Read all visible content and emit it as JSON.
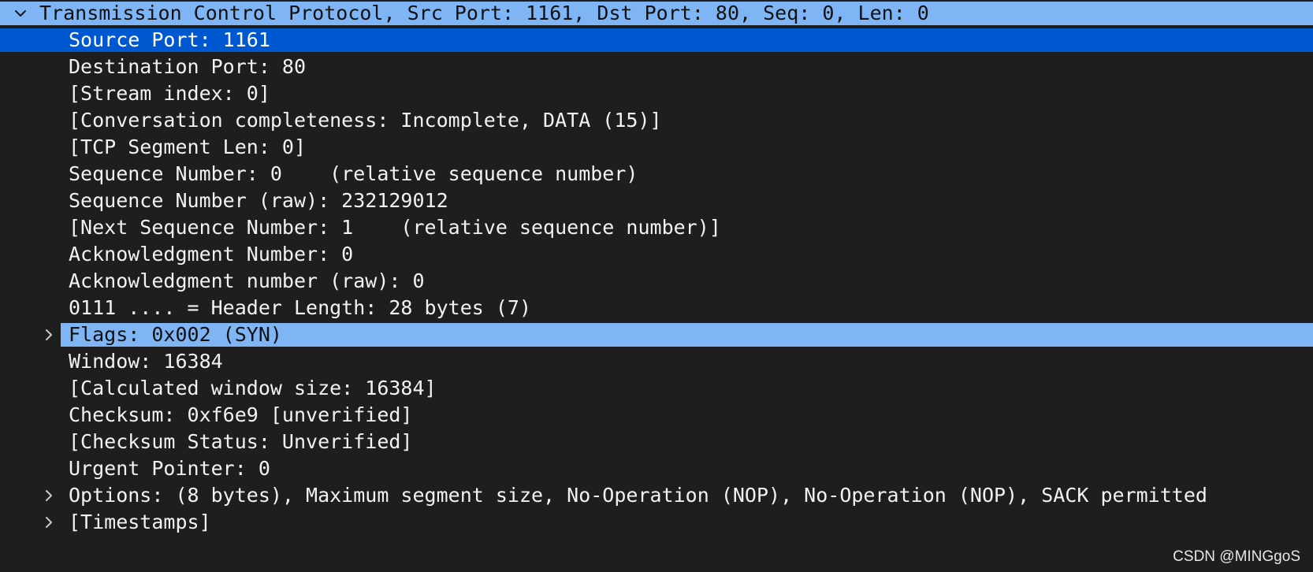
{
  "colors": {
    "background": "#1e1e1e",
    "root_highlight": "#7fb5f5",
    "selected_highlight": "#0058d0",
    "related_highlight": "#7fb5f5"
  },
  "tree": {
    "root": {
      "label": "Transmission Control Protocol, Src Port: 1161, Dst Port: 80, Seq: 0, Len: 0",
      "expanded": true,
      "icon": "chevron-down-icon"
    },
    "fields": [
      {
        "label": "Source Port: 1161",
        "state": "selected"
      },
      {
        "label": "Destination Port: 80"
      },
      {
        "label": "[Stream index: 0]"
      },
      {
        "label": "[Conversation completeness: Incomplete, DATA (15)]"
      },
      {
        "label": "[TCP Segment Len: 0]"
      },
      {
        "label": "Sequence Number: 0    (relative sequence number)"
      },
      {
        "label": "Sequence Number (raw): 232129012"
      },
      {
        "label": "[Next Sequence Number: 1    (relative sequence number)]"
      },
      {
        "label": "Acknowledgment Number: 0"
      },
      {
        "label": "Acknowledgment number (raw): 0"
      },
      {
        "label": "0111 .... = Header Length: 28 bytes (7)"
      },
      {
        "label": "Flags: 0x002 (SYN)",
        "state": "related",
        "expandable": true,
        "icon": "chevron-right-icon"
      },
      {
        "label": "Window: 16384"
      },
      {
        "label": "[Calculated window size: 16384]"
      },
      {
        "label": "Checksum: 0xf6e9 [unverified]"
      },
      {
        "label": "[Checksum Status: Unverified]"
      },
      {
        "label": "Urgent Pointer: 0"
      },
      {
        "label": "Options: (8 bytes), Maximum segment size, No-Operation (NOP), No-Operation (NOP), SACK permitted",
        "expandable": true,
        "icon": "chevron-right-icon"
      },
      {
        "label": "[Timestamps]",
        "expandable": true,
        "icon": "chevron-right-icon"
      }
    ]
  },
  "watermark": "CSDN @MINGgoS"
}
